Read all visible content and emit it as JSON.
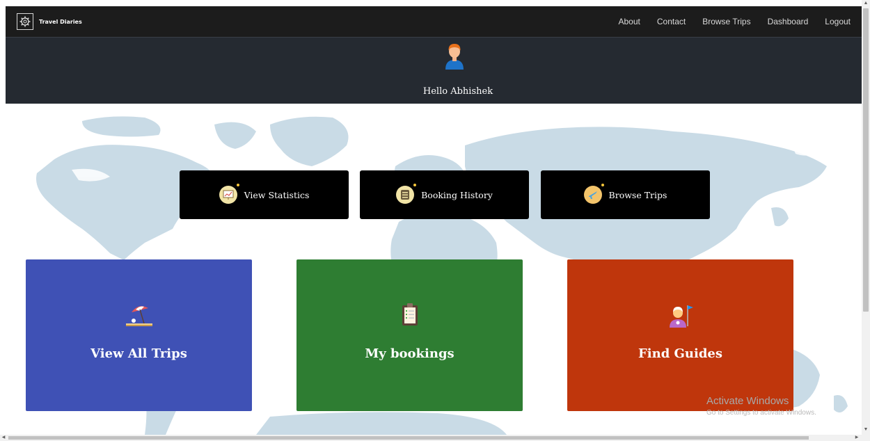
{
  "brand": {
    "name": "Travel Diaries",
    "icon": "gear-logo-icon"
  },
  "nav": {
    "links": [
      "About",
      "Contact",
      "Browse Trips",
      "Dashboard",
      "Logout"
    ]
  },
  "profile": {
    "greeting": "Hello Abhishek",
    "avatar_icon": "user-avatar-icon"
  },
  "quick_actions": [
    {
      "label": "View Statistics",
      "icon": "statistics-icon"
    },
    {
      "label": "Booking History",
      "icon": "history-list-icon"
    },
    {
      "label": "Browse Trips",
      "icon": "airplane-icon"
    }
  ],
  "cards": [
    {
      "label": "View All Trips",
      "icon": "beach-umbrella-icon",
      "color": "#3f51b5"
    },
    {
      "label": "My bookings",
      "icon": "clipboard-icon",
      "color": "#2e7d32"
    },
    {
      "label": "Find Guides",
      "icon": "guide-person-icon",
      "color": "#bf360c"
    }
  ],
  "watermark": {
    "title": "Activate Windows",
    "subtitle": "Go to Settings to activate Windows."
  },
  "colors": {
    "navbar": "#1c1c1c",
    "profile_header": "#252a31",
    "map": "#c9dbe6"
  }
}
